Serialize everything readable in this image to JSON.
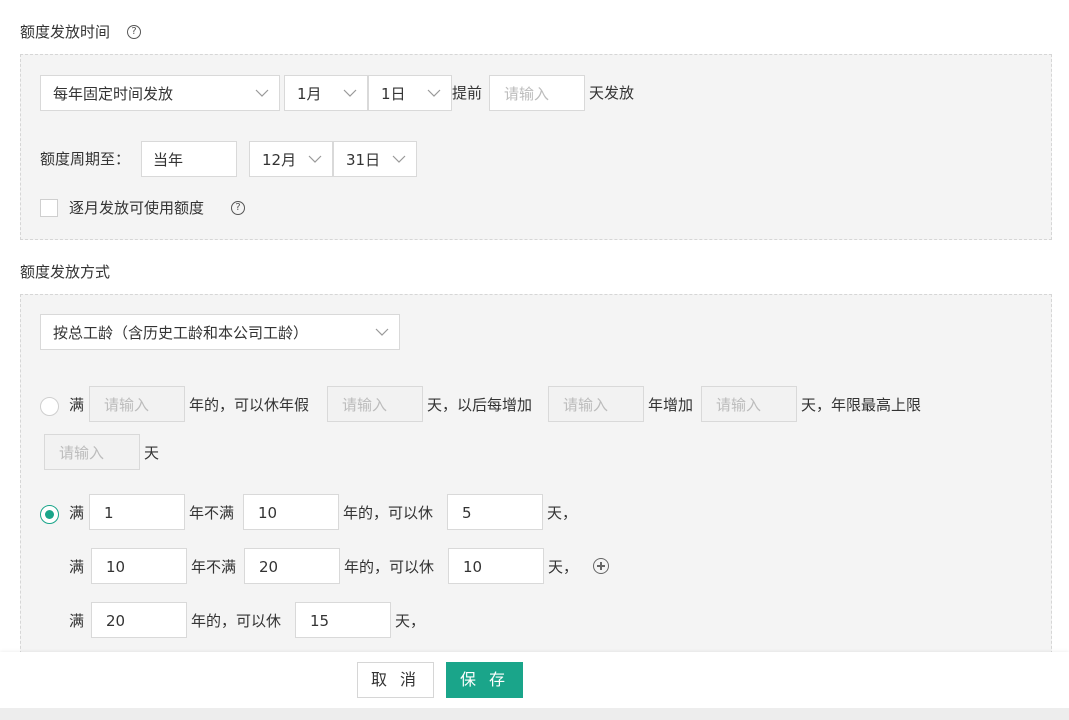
{
  "section1": {
    "title": "额度发放时间",
    "schedule_select": "每年固定时间发放",
    "month_select": "1月",
    "day_select": "1日",
    "advance_prefix": "提前",
    "advance_placeholder": "请输入",
    "advance_suffix": "天发放",
    "period_label": "额度周期至：",
    "period_year": "当年",
    "period_month": "12月",
    "period_day": "31日",
    "monthly_checkbox_label": "逐月发放可使用额度"
  },
  "section2": {
    "title": "额度发放方式",
    "method_select": "按总工龄（含历史工龄和本公司工龄）",
    "option1": {
      "t_man": "满",
      "ph": "请输入",
      "t_year_can": "年的，可以休年假",
      "t_day_after": "天，以后每增加",
      "t_year_add": "年增加",
      "t_day_max": "天，年限最高上限",
      "t_day": "天"
    },
    "option2": {
      "tier1": {
        "man": "满",
        "from": "1",
        "mid": "年不满",
        "to": "10",
        "can": "年的，可以休",
        "days": "5",
        "unit": "天，"
      },
      "tier2": {
        "man": "满",
        "from": "10",
        "mid": "年不满",
        "to": "20",
        "can": "年的，可以休",
        "days": "10",
        "unit": "天，"
      },
      "tier3": {
        "man": "满",
        "from": "20",
        "can": "年的，可以休",
        "days": "15",
        "unit": "天，"
      }
    }
  },
  "footer": {
    "cancel": "取 消",
    "save": "保 存"
  },
  "colors": {
    "accent": "#1aa58a",
    "panel_bg": "#f4f4f4"
  },
  "icons": {
    "help": "question-circle-icon",
    "add": "plus-circle-icon",
    "dropdown": "chevron-down-icon"
  }
}
